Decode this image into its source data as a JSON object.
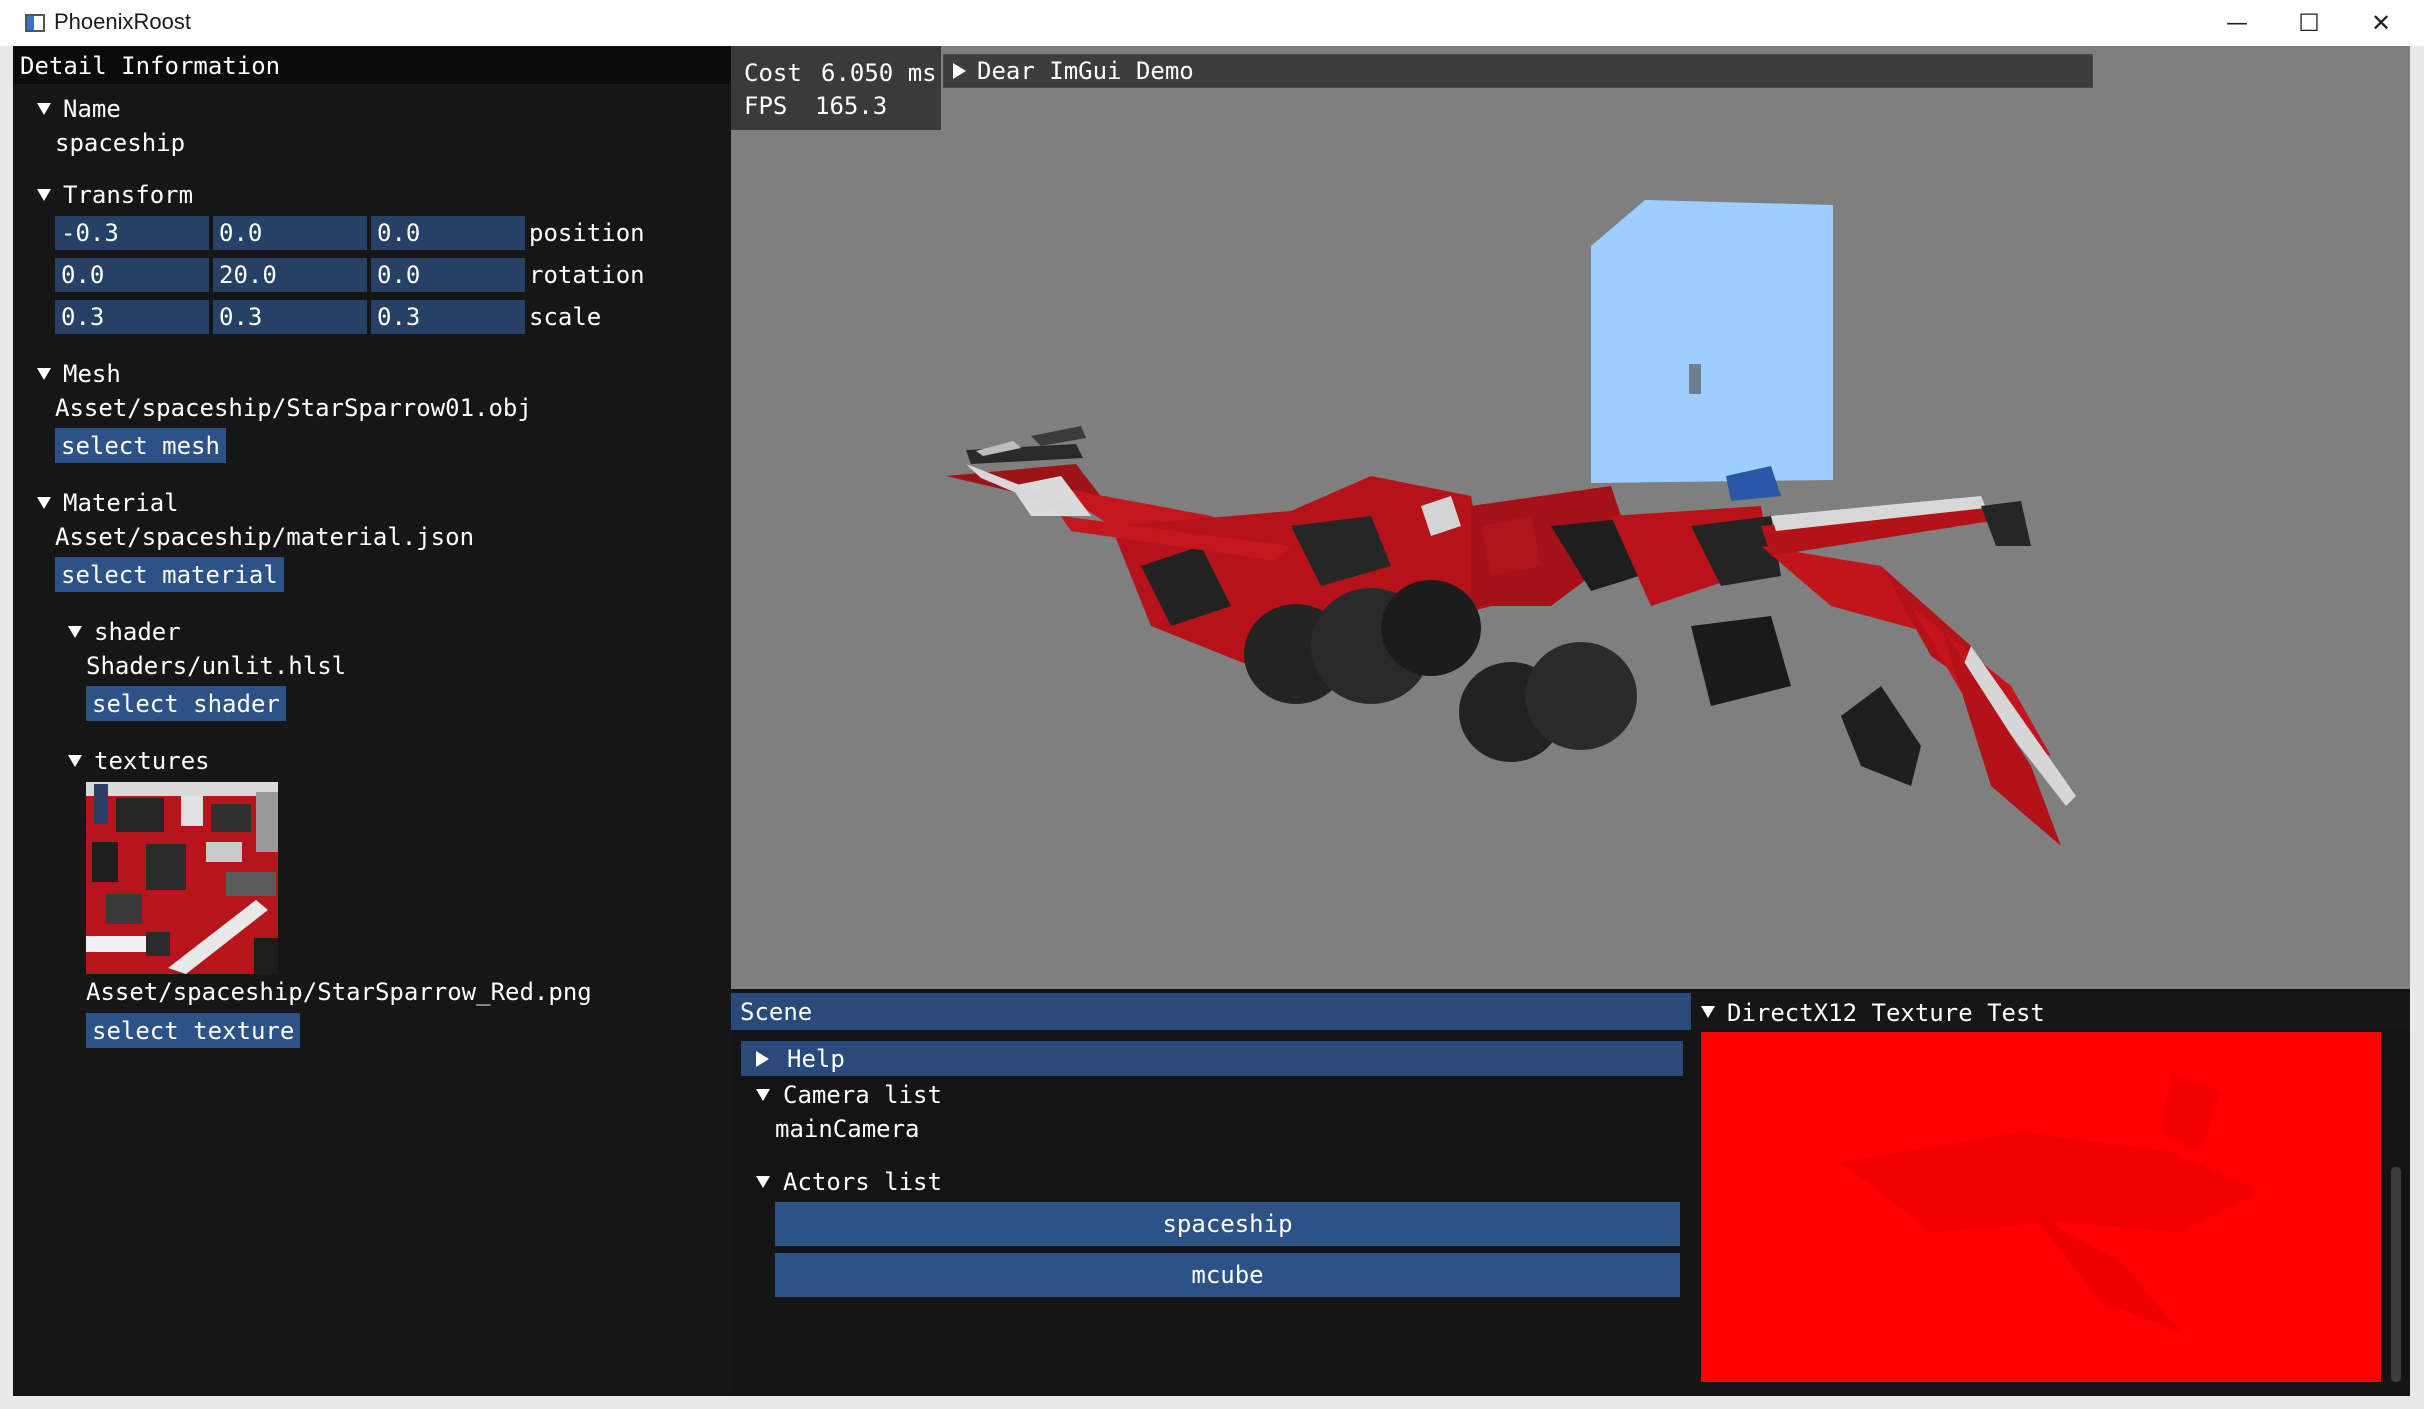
{
  "window": {
    "title": "PhoenixRoost",
    "minimize_glyph": "—",
    "maximize_glyph": "☐",
    "close_glyph": "✕"
  },
  "detail": {
    "header": "Detail Information",
    "name": {
      "label": "Name",
      "value": "spaceship"
    },
    "transform": {
      "label": "Transform",
      "rows": [
        {
          "label": "position",
          "values": [
            "-0.3",
            "0.0",
            "0.0"
          ]
        },
        {
          "label": "rotation",
          "values": [
            "0.0",
            "20.0",
            "0.0"
          ]
        },
        {
          "label": "scale",
          "values": [
            "0.3",
            "0.3",
            "0.3"
          ]
        }
      ]
    },
    "mesh": {
      "label": "Mesh",
      "path": "Asset/spaceship/StarSparrow01.obj",
      "button": "select mesh"
    },
    "material": {
      "label": "Material",
      "path": "Asset/spaceship/material.json",
      "button": "select material",
      "shader": {
        "label": "shader",
        "path": "Shaders/unlit.hlsl",
        "button": "select shader"
      },
      "textures": {
        "label": "textures",
        "path": "Asset/spaceship/StarSparrow_Red.png",
        "button": "select texture"
      }
    }
  },
  "viewport": {
    "cost_label": "Cost",
    "cost_value": "6.050 ms",
    "fps_label": "FPS",
    "fps_value": "165.3",
    "demo_window": "Dear ImGui Demo"
  },
  "scene": {
    "header": "Scene",
    "help": "Help",
    "camera_list": {
      "label": "Camera list",
      "items": [
        "mainCamera"
      ]
    },
    "actors_list": {
      "label": "Actors list",
      "items": [
        "spaceship",
        "mcube"
      ]
    }
  },
  "texture_test": {
    "title": "DirectX12 Texture Test"
  },
  "colors": {
    "panel_bg": "#161616",
    "header_active": "#294a7a",
    "field_bg": "#274066",
    "button_bg": "#2d5287",
    "viewport_bg": "#7f7f7f",
    "texture_red": "#fe0000",
    "cube_blue": "#9fcdfd",
    "ship_red": "#b0141c"
  },
  "icons": {
    "app": "app-window-icon",
    "expanded": "tree-expanded-icon",
    "collapsed": "tree-collapsed-icon"
  }
}
